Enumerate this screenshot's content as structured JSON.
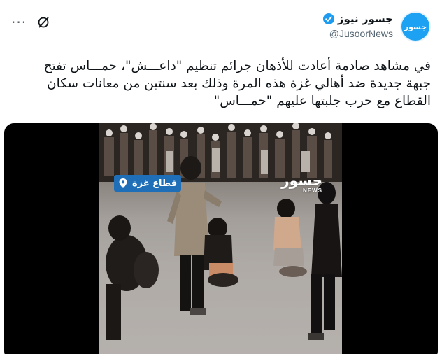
{
  "author": {
    "display_name": "جسور نيوز",
    "handle": "@JusoorNews",
    "avatar_text": "جسور"
  },
  "tweet": {
    "text": "في مشاهد صادمة أعادت للأذهان جرائم تنظيم \"داعـــش\"، حمـــاس تفتح جبهة جديدة ضد أهالي غزة هذه المرة وذلك بعد سنتين من معانات سكان القطاع مع حرب جلبتها عليهم \"حمـــاس\""
  },
  "actions": {
    "more_label": "···"
  },
  "media": {
    "location_label": "قطاع غزة",
    "watermark_text": "جسور",
    "watermark_sub": "NEWS"
  },
  "colors": {
    "accent": "#1d9bf0",
    "badge_bg": "#1e6fb8",
    "secondary_text": "#536471"
  },
  "icons": {
    "more": "more-icon",
    "grok": "grok-icon",
    "verified": "verified-icon",
    "location": "pin-icon"
  }
}
